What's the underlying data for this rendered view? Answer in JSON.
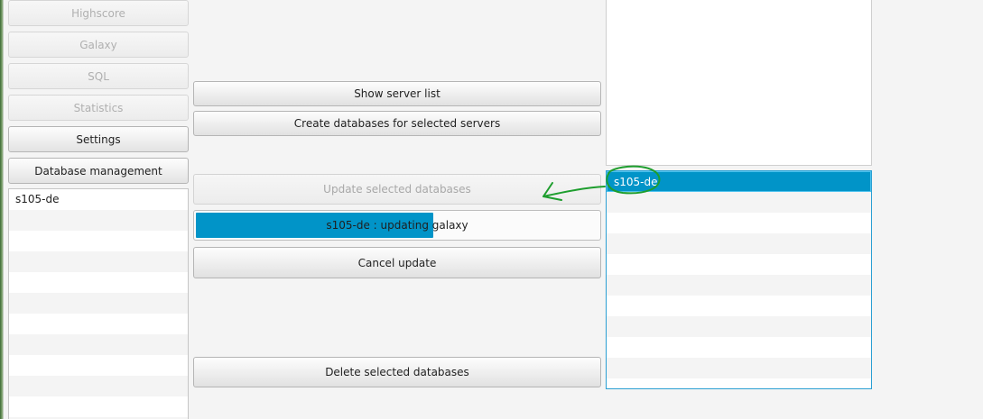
{
  "nav": {
    "highscore": "Highscore",
    "galaxy": "Galaxy",
    "sql": "SQL",
    "statistics": "Statistics",
    "settings": "Settings",
    "database_management": "Database management"
  },
  "server_list": {
    "items": [
      "s105-de"
    ]
  },
  "actions": {
    "show_server_list": "Show server list",
    "create_databases": "Create databases for selected servers",
    "update_databases": "Update selected databases",
    "cancel_update": "Cancel update",
    "delete_databases": "Delete selected databases"
  },
  "progress": {
    "label": "s105-de : updating galaxy",
    "fraction": 0.59
  },
  "database_list": {
    "items": [
      "s105-de"
    ],
    "selected_index": 0
  },
  "colors": {
    "accent": "#0194c8",
    "annotation": "#1e9e2e"
  }
}
